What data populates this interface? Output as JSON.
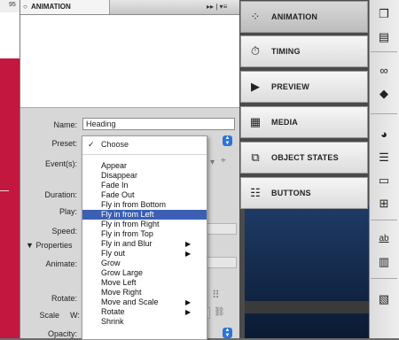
{
  "document": {
    "ruler_number": "95"
  },
  "panel": {
    "tab_label": "ANIMATION",
    "menu_glyph": "▸▸ | ▾≡",
    "fields": {
      "name_label": "Name:",
      "name_value": "Heading",
      "preset_label": "Preset:",
      "events_label": "Event(s):",
      "duration_label": "Duration:",
      "play_label": "Play:",
      "speed_label": "Speed:",
      "properties_label": "Properties",
      "animate_label": "Animate:",
      "rotate_label": "Rotate:",
      "scale_label": "Scale",
      "scale_w_label": "W:",
      "opacity_label": "Opacity:"
    }
  },
  "preset_menu": {
    "checked_item": "Choose",
    "selected_item": "Fly in from Left",
    "items": [
      {
        "label": "Appear",
        "submenu": false
      },
      {
        "label": "Disappear",
        "submenu": false
      },
      {
        "label": "Fade In",
        "submenu": false
      },
      {
        "label": "Fade Out",
        "submenu": false
      },
      {
        "label": "Fly in from Bottom",
        "submenu": false
      },
      {
        "label": "Fly in from Left",
        "submenu": false
      },
      {
        "label": "Fly in from Right",
        "submenu": false
      },
      {
        "label": "Fly in from Top",
        "submenu": false
      },
      {
        "label": "Fly in and Blur",
        "submenu": true
      },
      {
        "label": "Fly out",
        "submenu": true
      },
      {
        "label": "Grow",
        "submenu": false
      },
      {
        "label": "Grow Large",
        "submenu": false
      },
      {
        "label": "Move Left",
        "submenu": false
      },
      {
        "label": "Move Right",
        "submenu": false
      },
      {
        "label": "Move and Scale",
        "submenu": true
      },
      {
        "label": "Rotate",
        "submenu": true
      },
      {
        "label": "Shrink",
        "submenu": false
      }
    ]
  },
  "dock": {
    "buttons": [
      {
        "label": "ANIMATION",
        "icon": "animation-icon"
      },
      {
        "label": "TIMING",
        "icon": "stopwatch-icon"
      },
      {
        "label": "PREVIEW",
        "icon": "preview-icon"
      },
      {
        "label": "MEDIA",
        "icon": "film-icon"
      },
      {
        "label": "OBJECT STATES",
        "icon": "object-states-icon"
      },
      {
        "label": "BUTTONS",
        "icon": "buttons-icon"
      }
    ]
  },
  "right_strip": {
    "icons": [
      "pages-icon",
      "layers-icon",
      "links-icon",
      "stroke-icon",
      "color-icon",
      "swatches-icon",
      "gradient-icon",
      "table-icon",
      "spelling-icon",
      "book-icon",
      "library-icon"
    ]
  },
  "colors": {
    "selection": "#3c5fb4",
    "document_red": "#c3173f",
    "stepper_blue": "#2c74d8"
  }
}
